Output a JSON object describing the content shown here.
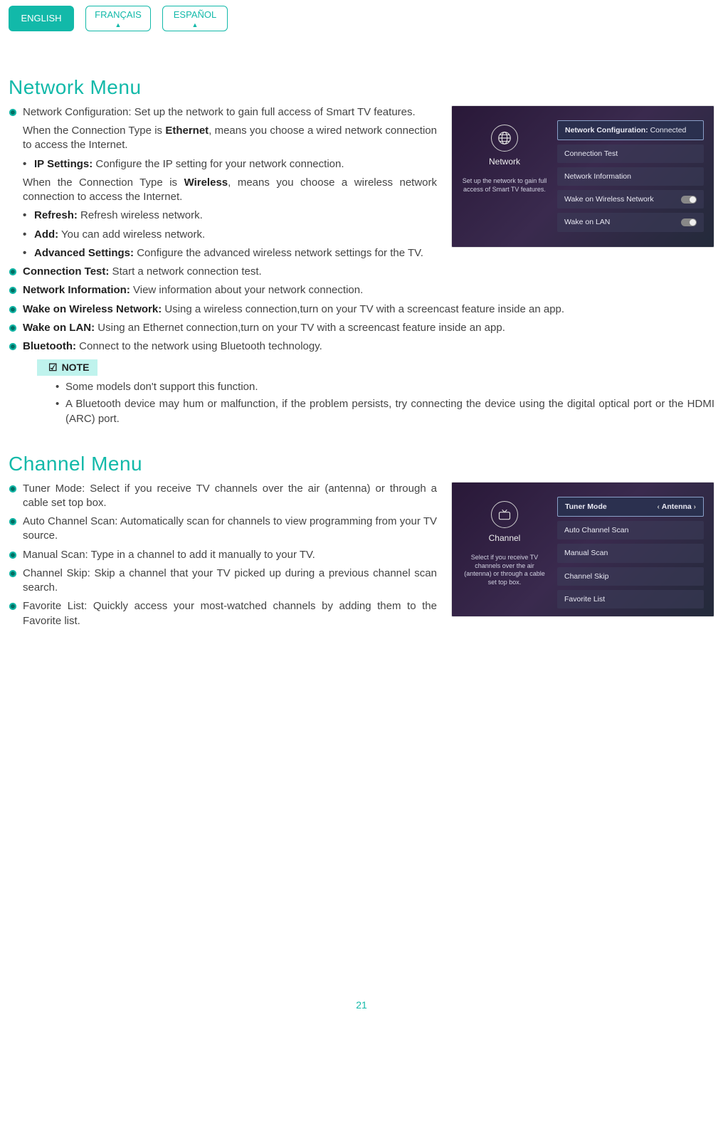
{
  "tabs": {
    "english": "ENGLISH",
    "francais": "FRANÇAIS",
    "espanol": "ESPAÑOL"
  },
  "network": {
    "heading": "Network Menu",
    "items": {
      "config_lead": "Network Configuration:",
      "config_text": " Set up the network to gain full access of Smart TV features.",
      "ethernet_p1": "When the Connection Type is ",
      "ethernet_bold": "Ethernet",
      "ethernet_p2": ", means you choose a wired network connection to access the Internet.",
      "ip_lead": "IP Settings:",
      "ip_text": " Configure the IP setting for your network connection.",
      "wireless_p1": "When the Connection Type is ",
      "wireless_bold": "Wireless",
      "wireless_p2": ", means you choose a wireless network connection to access the Internet.",
      "refresh_lead": "Refresh:",
      "refresh_text": " Refresh wireless network.",
      "add_lead": "Add:",
      "add_text": " You can add wireless network.",
      "adv_lead": "Advanced Settings:",
      "adv_text": " Configure the advanced wireless network settings for the TV.",
      "conntest_lead": "Connection Test:",
      "conntest_text": " Start a network connection test.",
      "netinfo_lead": "Network Information:",
      "netinfo_text": " View information about your network connection.",
      "wown_lead": "Wake on Wireless Network:",
      "wown_text": " Using a wireless connection,turn on your TV with a screencast feature inside an app.",
      "wol_lead": "Wake on LAN:",
      "wol_text": " Using an Ethernet connection,turn on your TV with a screencast feature inside an app.",
      "bt_lead": "Bluetooth:",
      "bt_text": " Connect to the network using Bluetooth technology."
    },
    "note_label": "NOTE",
    "notes": [
      "Some models don't support this function.",
      "A Bluetooth device may hum or malfunction, if the problem persists, try connecting the device using the digital optical port or the HDMI (ARC) port."
    ],
    "panel": {
      "side_label": "Network",
      "side_desc": "Set up the network to gain full access of Smart TV features.",
      "row_config_lead": "Network Configuration:",
      "row_config_val": " Connected",
      "row_conntest": "Connection Test",
      "row_netinfo": "Network Information",
      "row_wown": "Wake on Wireless Network",
      "row_wol": "Wake on LAN"
    }
  },
  "channel": {
    "heading": "Channel Menu",
    "items": {
      "tuner_lead": "Tuner Mode:",
      "tuner_text": " Select if you receive TV channels over the air (antenna) or through a cable set top box.",
      "auto_lead": "Auto Channel Scan:",
      "auto_text": " Automatically scan for channels to view programming from your TV source.",
      "manual_lead": "Manual Scan:",
      "manual_text": " Type in a channel to add it manually to your TV.",
      "skip_lead": "Channel Skip:",
      "skip_text": " Skip a channel that your TV picked up during a previous channel scan search.",
      "fav_lead": "Favorite List:",
      "fav_text": " Quickly access your most-watched channels by adding them to the Favorite list."
    },
    "panel": {
      "side_label": "Channel",
      "side_desc": "Select if you receive TV channels over the air (antenna) or through a cable set top box.",
      "row_tuner": "Tuner Mode",
      "row_tuner_val": "Antenna",
      "row_auto": "Auto Channel Scan",
      "row_manual": "Manual Scan",
      "row_skip": "Channel Skip",
      "row_fav": "Favorite List"
    }
  },
  "page_number": "21"
}
